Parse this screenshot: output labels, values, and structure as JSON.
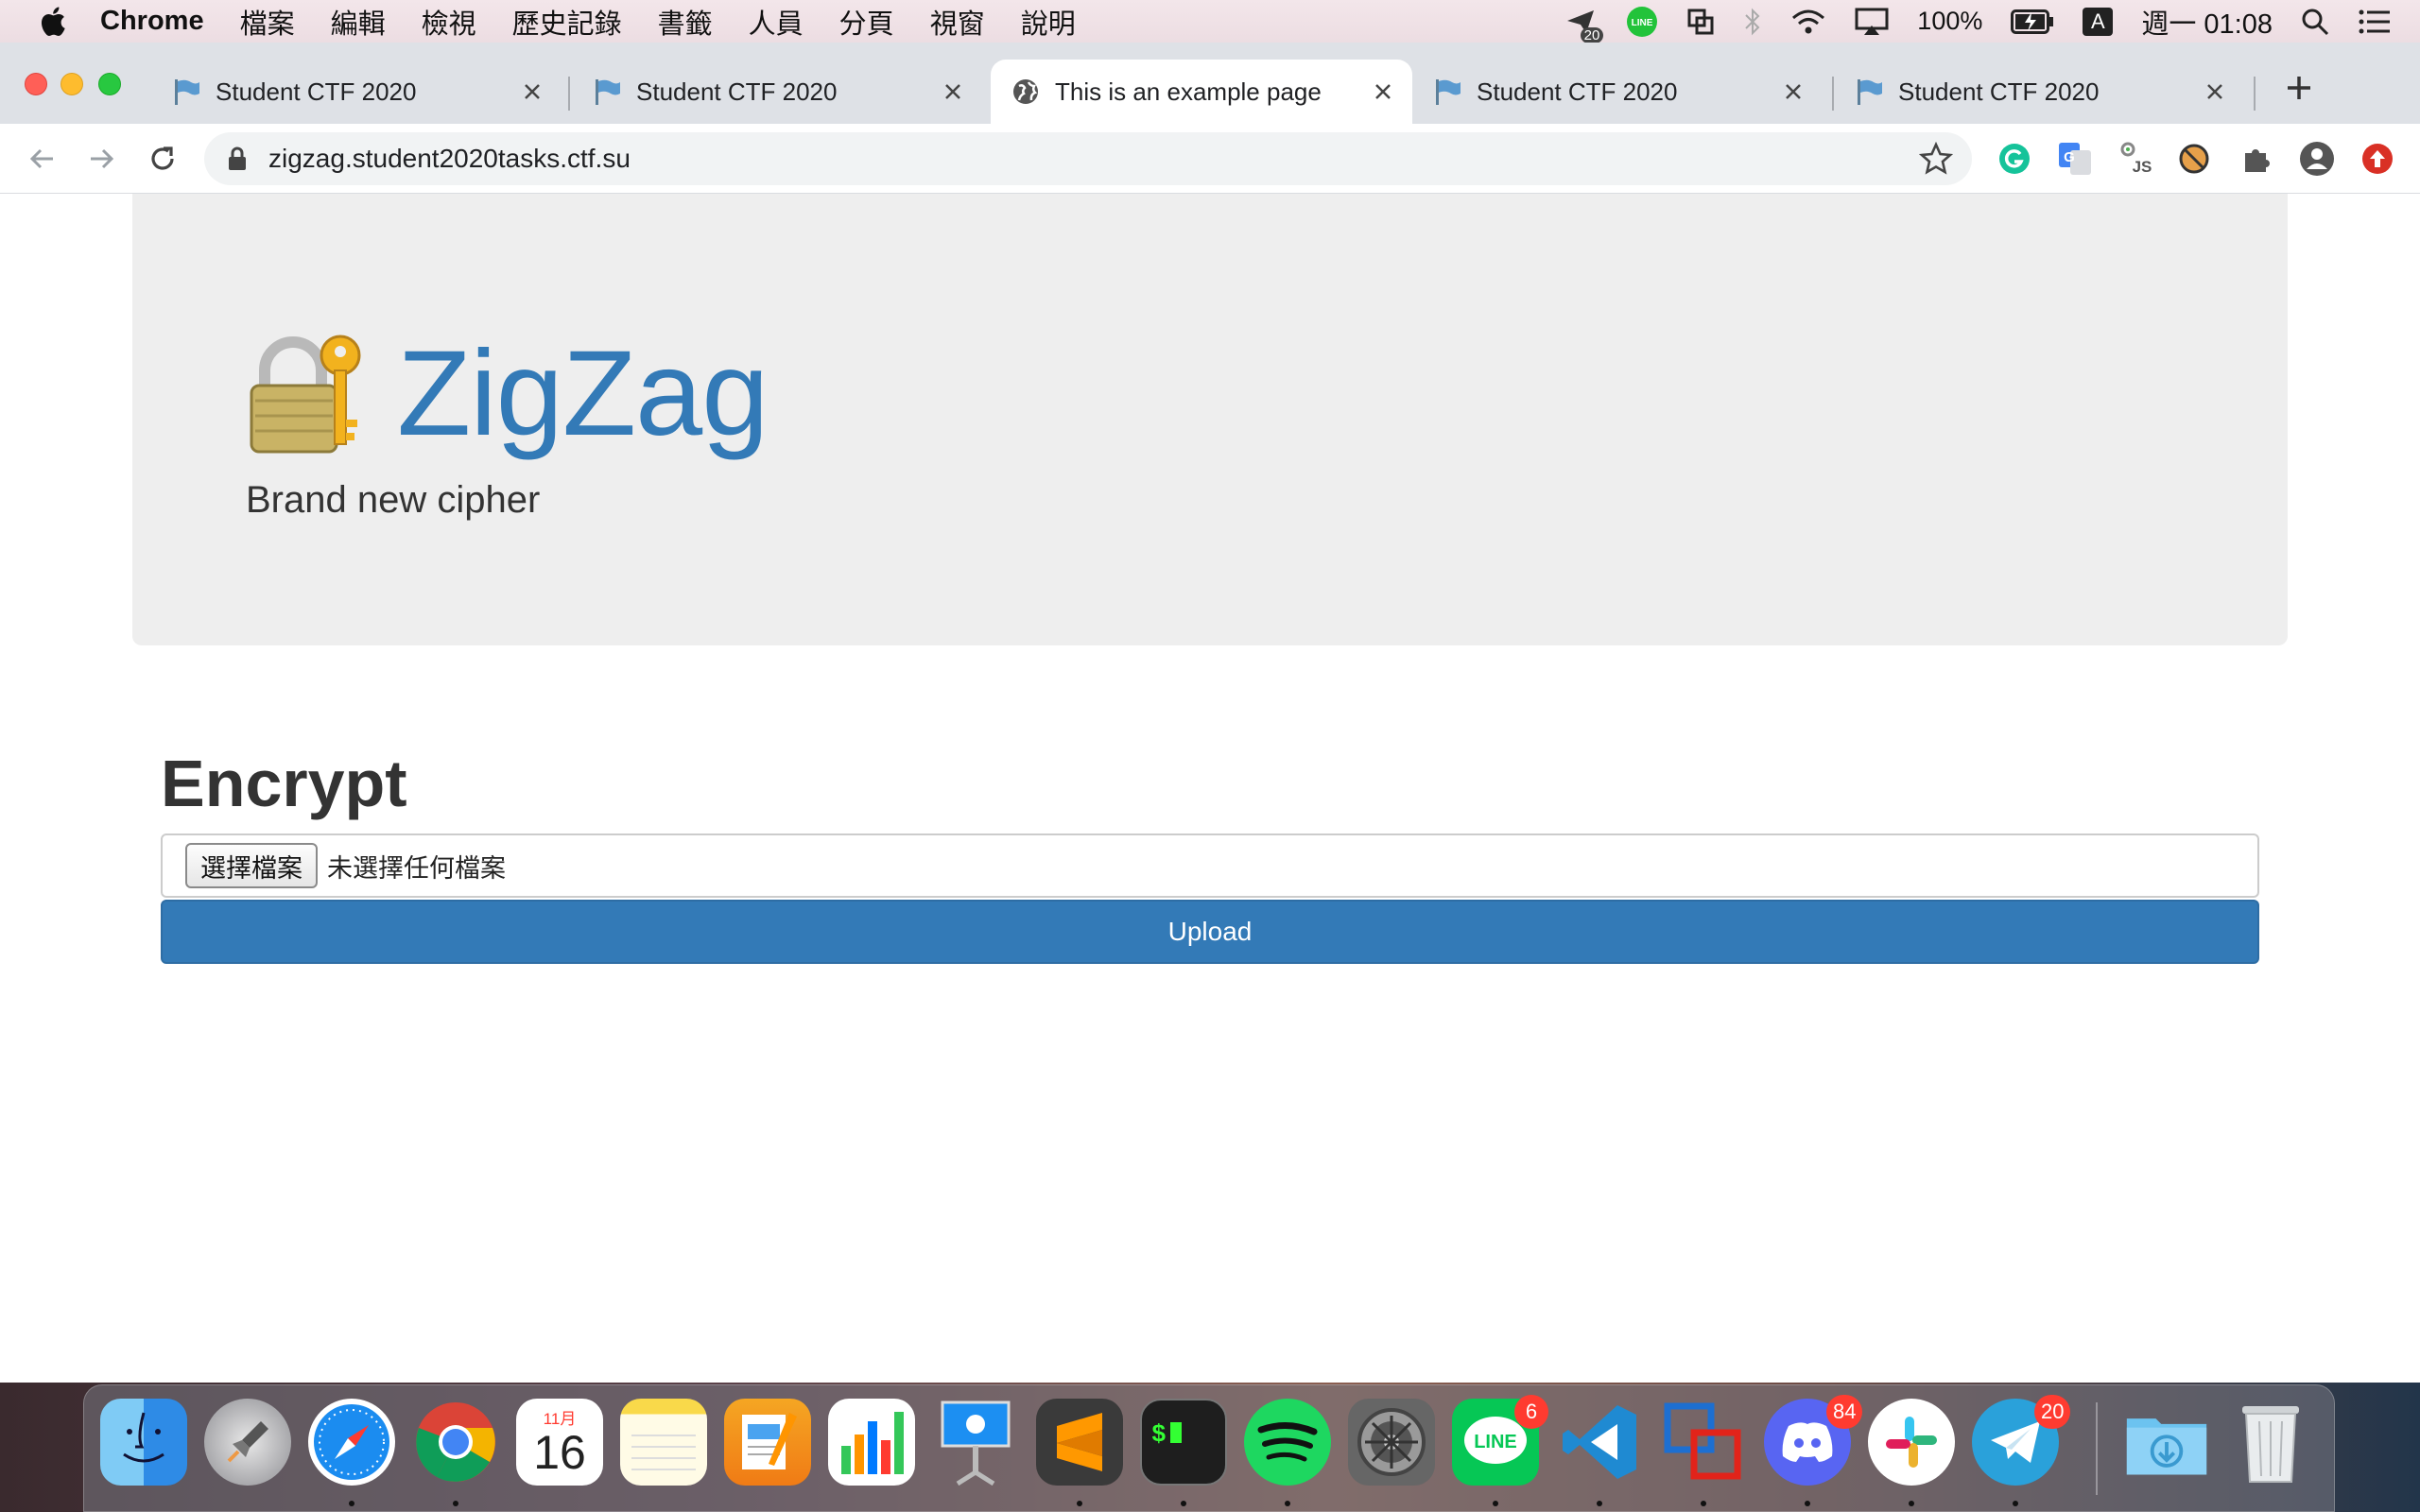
{
  "menubar": {
    "app_name": "Chrome",
    "menus": [
      "檔案",
      "編輯",
      "檢視",
      "歷史記錄",
      "書籤",
      "人員",
      "分頁",
      "視窗",
      "說明"
    ],
    "notification_count": "20",
    "battery": "100%",
    "input_source": "A",
    "clock": "週一 01:08"
  },
  "browser": {
    "tabs": [
      {
        "title": "Student CTF 2020",
        "icon": "flag-icon",
        "active": false
      },
      {
        "title": "Student CTF 2020",
        "icon": "flag-icon",
        "active": false
      },
      {
        "title": "This is an example page",
        "icon": "globe-icon",
        "active": true
      },
      {
        "title": "Student CTF 2020",
        "icon": "flag-icon",
        "active": false
      },
      {
        "title": "Student CTF 2020",
        "icon": "flag-icon",
        "active": false
      }
    ],
    "url": "zigzag.student2020tasks.ctf.su",
    "extensions": [
      "grammarly-icon",
      "google-translate-icon",
      "js-icon",
      "blocker-icon",
      "puzzle-icon",
      "profile-icon",
      "update-icon"
    ]
  },
  "page": {
    "brand_title": "ZigZag",
    "tagline": "Brand new cipher",
    "section_title": "Encrypt",
    "file_button_label": "選擇檔案",
    "file_status": "未選擇任何檔案",
    "upload_label": "Upload"
  },
  "dock": {
    "apps": [
      {
        "name": "finder-icon",
        "running": true
      },
      {
        "name": "launchpad-icon",
        "running": false
      },
      {
        "name": "safari-icon",
        "running": true
      },
      {
        "name": "chrome-icon",
        "running": true
      },
      {
        "name": "calendar-icon",
        "running": false,
        "month": "11月",
        "day": "16"
      },
      {
        "name": "notes-icon",
        "running": false
      },
      {
        "name": "pages-icon",
        "running": false
      },
      {
        "name": "numbers-icon",
        "running": false
      },
      {
        "name": "keynote-icon",
        "running": false
      },
      {
        "name": "sublime-text-icon",
        "running": true
      },
      {
        "name": "terminal-icon",
        "running": true
      },
      {
        "name": "spotify-icon",
        "running": true
      },
      {
        "name": "system-preferences-icon",
        "running": false
      },
      {
        "name": "line-icon",
        "running": true,
        "badge": "6"
      },
      {
        "name": "vscode-icon",
        "running": true
      },
      {
        "name": "vmware-icon",
        "running": true
      },
      {
        "name": "discord-icon",
        "running": true,
        "badge": "84"
      },
      {
        "name": "slack-icon",
        "running": true
      },
      {
        "name": "telegram-icon",
        "running": true,
        "badge": "20"
      },
      {
        "name": "downloads-folder-icon",
        "running": false
      },
      {
        "name": "trash-icon",
        "running": false
      }
    ]
  },
  "colors": {
    "brand": "#337ab7",
    "jumbotron_bg": "#eeeeee",
    "tabstrip_bg": "#dee1e6"
  }
}
